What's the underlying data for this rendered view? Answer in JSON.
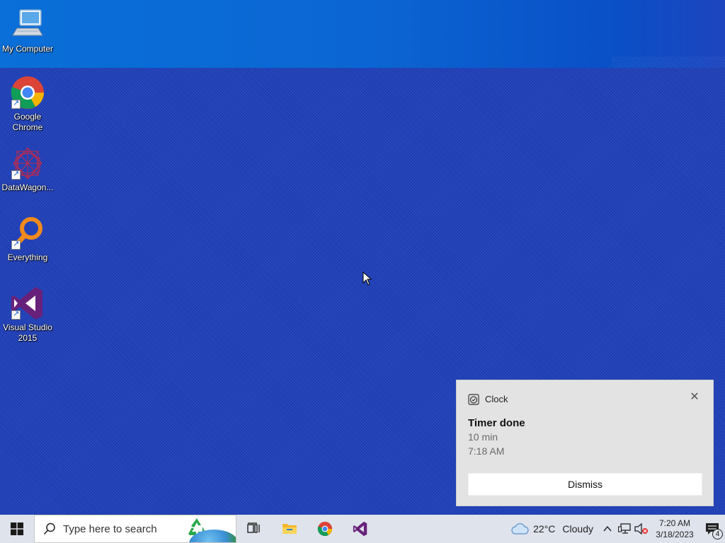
{
  "desktop": {
    "icons": [
      {
        "label": "My Computer"
      },
      {
        "label": "Google Chrome"
      },
      {
        "label": "DataWagon..."
      },
      {
        "label": "Everything"
      },
      {
        "label": "Visual Studio 2015"
      }
    ]
  },
  "notification": {
    "app_name": "Clock",
    "title": "Timer done",
    "line1": "10 min",
    "line2": "7:18 AM",
    "dismiss_label": "Dismiss",
    "close_glyph": "✕"
  },
  "taskbar": {
    "search_placeholder": "Type here to search",
    "pinned": [
      "task-view-icon",
      "file-explorer-icon",
      "chrome-icon",
      "visual-studio-icon"
    ],
    "weather": {
      "temp": "22°C",
      "condition": "Cloudy"
    },
    "clock": {
      "time": "7:20 AM",
      "date": "3/18/2023"
    },
    "notification_count": "4",
    "chevron": "^"
  },
  "colors": {
    "wallpaper": "#1f40b9",
    "taskbar": "#dfe3ec",
    "toast_bg": "#e3e3e3"
  }
}
